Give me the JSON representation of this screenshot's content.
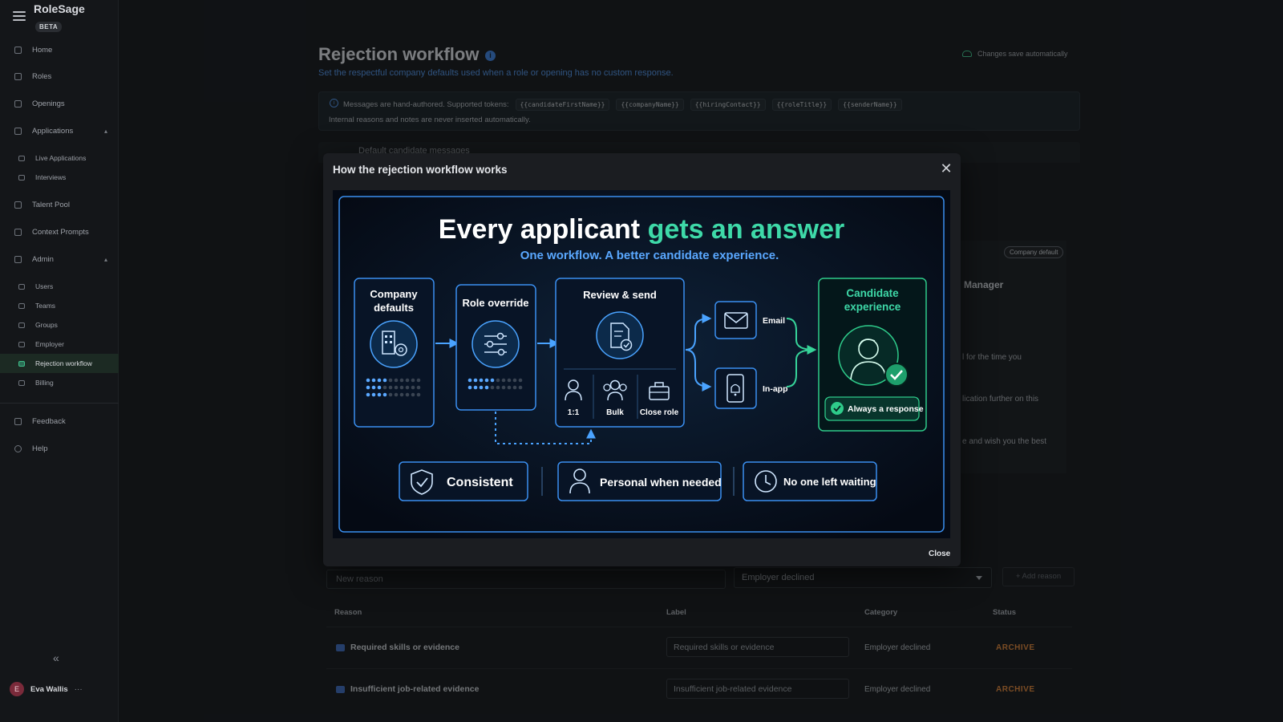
{
  "app": {
    "name": "RoleSage",
    "badge": "BETA"
  },
  "sidebar": {
    "items": [
      {
        "label": "Home"
      },
      {
        "label": "Roles"
      },
      {
        "label": "Openings"
      },
      {
        "label": "Applications"
      },
      {
        "label": "Live Applications"
      },
      {
        "label": "Interviews"
      },
      {
        "label": "Talent Pool"
      },
      {
        "label": "Context Prompts"
      },
      {
        "label": "Admin"
      },
      {
        "label": "Users"
      },
      {
        "label": "Teams"
      },
      {
        "label": "Groups"
      },
      {
        "label": "Employer"
      },
      {
        "label": "Rejection workflow"
      },
      {
        "label": "Billing"
      },
      {
        "label": "Feedback"
      },
      {
        "label": "Help"
      }
    ],
    "active": "Rejection workflow",
    "user": {
      "initial": "E",
      "name": "Eva Wallis",
      "more": "···"
    },
    "collapse_icon": "«"
  },
  "page": {
    "title": "Rejection workflow",
    "subtitle": "Set the respectful company defaults used when a role or opening has no custom response.",
    "autosave": "Changes save automatically",
    "notice": {
      "line1": "Messages are hand-authored. Supported tokens:",
      "tokens": [
        "{{candidateFirstName}}",
        "{{companyName}}",
        "{{hiringContact}}",
        "{{roleTitle}}",
        "{{senderName}}"
      ],
      "line2": "Internal reasons and notes are never inserted automatically."
    },
    "section_title": "Default candidate messages",
    "company_default_badge": "Company default",
    "manager_label": "Manager",
    "text_fragments": [
      "l for the time you",
      "lication further on this",
      "e and wish you the best"
    ],
    "new_reason": {
      "placeholder": "New reason"
    },
    "category_select": {
      "value": "Employer declined"
    },
    "add_reason_label": "Add reason",
    "table": {
      "headers": [
        "Reason",
        "Label",
        "Category",
        "Status"
      ],
      "rows": [
        {
          "reason": "Required skills or evidence",
          "label": "Required skills or evidence",
          "category": "Employer declined",
          "status": "ARCHIVE"
        },
        {
          "reason": "Insufficient job-related evidence",
          "label": "Insufficient job-related evidence",
          "category": "Employer declined",
          "status": "ARCHIVE"
        }
      ]
    }
  },
  "modal": {
    "title": "How the rejection workflow works",
    "close_label": "Close",
    "infographic": {
      "headline_a": "Every applicant ",
      "headline_b": "gets an answer",
      "tagline": "One workflow. A better candidate experience.",
      "step1": [
        "Company",
        "defaults"
      ],
      "step2": "Role override",
      "step3": "Review & send",
      "modes": [
        "1:1",
        "Bulk",
        "Close role"
      ],
      "channels": [
        "Email",
        "In-app"
      ],
      "outcome": [
        "Candidate",
        "experience"
      ],
      "outcome_badge": "Always a response",
      "pillars": [
        "Consistent",
        "Personal when needed",
        "No one left waiting"
      ]
    }
  },
  "colors": {
    "accent_green": "#2ecb8a",
    "accent_blue": "#3f8ee8",
    "archive": "#d9823a"
  }
}
